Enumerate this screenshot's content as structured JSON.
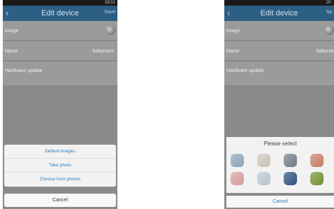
{
  "left": {
    "status_time": "29:01",
    "title": "Edit device",
    "save_label": "Save",
    "rows": [
      {
        "label": "Image",
        "value": ""
      },
      {
        "label": "Name",
        "value": "babyroom"
      },
      {
        "label": "Hardware update",
        "value": ""
      }
    ],
    "sheet_options": [
      "Default images",
      "Take photo",
      "Choose from photos"
    ],
    "cancel_label": "Cancel"
  },
  "right": {
    "status_time": "20:",
    "title": "Edit device",
    "save_label": "Sa",
    "rows": [
      {
        "label": "Image",
        "value": ""
      },
      {
        "label": "Name",
        "value": "babyroo"
      },
      {
        "label": "Hardware update",
        "value": ""
      }
    ],
    "picker_title": "Please select",
    "image_icons": [
      "bedroom-image-icon",
      "bathroom-image-icon",
      "bedroom2-image-icon",
      "kitchen-image-icon",
      "babyroom-image-icon",
      "livingroom-image-icon",
      "car-image-icon",
      "garden-image-icon"
    ],
    "icon_colors": [
      "#8aa3b8",
      "#c9c3b6",
      "#6e7a86",
      "#c47b62",
      "#d49a9a",
      "#b9c4cf",
      "#2d4e7a",
      "#6f8f2d"
    ],
    "cancel_label": "Cancel"
  }
}
